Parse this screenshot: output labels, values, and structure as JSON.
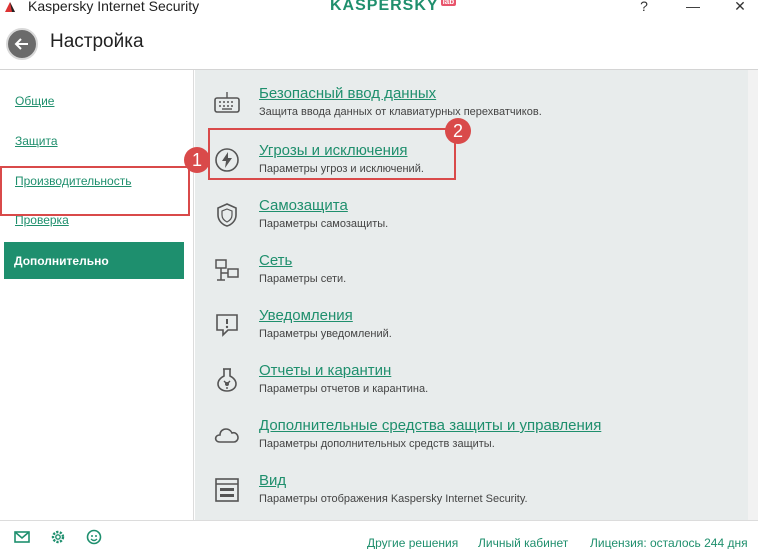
{
  "window": {
    "title": "Kaspersky Internet Security",
    "brand": "KASPERSKY",
    "brand_lab": "lab",
    "help": "?",
    "minimize": "—",
    "close": "✕"
  },
  "header": {
    "title": "Настройка"
  },
  "sidebar": {
    "items": [
      {
        "label": "Общие"
      },
      {
        "label": "Защита"
      },
      {
        "label": "Производительность"
      },
      {
        "label": "Проверка"
      },
      {
        "label": "Дополнительно",
        "active": true
      }
    ]
  },
  "annotations": {
    "badge1": "1",
    "badge2": "2"
  },
  "main": {
    "items": [
      {
        "icon": "keyboard-icon",
        "title": "Безопасный ввод данных",
        "desc": "Защита ввода данных от клавиатурных перехватчиков."
      },
      {
        "icon": "lightning-icon",
        "title": "Угрозы и исключения",
        "desc": "Параметры угроз и исключений."
      },
      {
        "icon": "shield-icon",
        "title": "Самозащита",
        "desc": "Параметры самозащиты."
      },
      {
        "icon": "network-icon",
        "title": "Сеть",
        "desc": "Параметры сети."
      },
      {
        "icon": "notification-icon",
        "title": "Уведомления",
        "desc": "Параметры уведомлений."
      },
      {
        "icon": "quarantine-flask-icon",
        "title": "Отчеты и карантин",
        "desc": "Параметры отчетов и карантина."
      },
      {
        "icon": "cloud-icon",
        "title": "Дополнительные средства защиты и управления",
        "desc": "Параметры дополнительных средств защиты."
      },
      {
        "icon": "window-view-icon",
        "title": "Вид",
        "desc": "Параметры отображения Kaspersky Internet Security."
      }
    ]
  },
  "footer": {
    "other_solutions": "Другие решения",
    "account": "Личный кабинет",
    "license": "Лицензия: осталось 244 дня"
  },
  "colors": {
    "accent": "#1e8f6e",
    "annotation": "#d94a4a",
    "panel": "#e8ecec"
  }
}
